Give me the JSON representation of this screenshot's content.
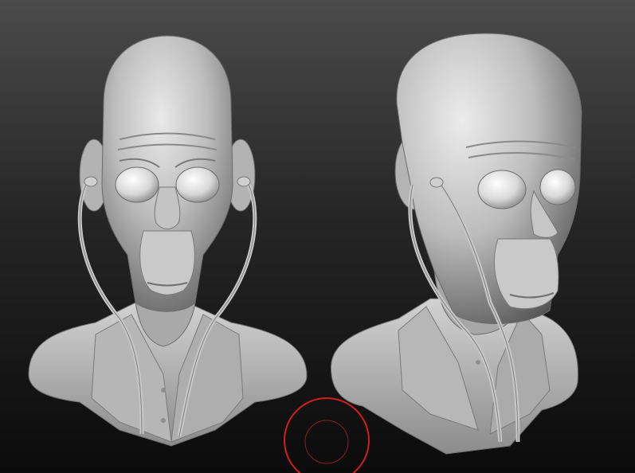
{
  "viewport": {
    "background_top": "#4a4a4a",
    "background_bottom": "#0d0d0d",
    "material_color": "#b9b9b9",
    "material_shadow": "#3c3c3c"
  },
  "models": [
    {
      "name": "bust-front-view",
      "icon": "sculpt-bust"
    },
    {
      "name": "bust-three-quarter-view",
      "icon": "sculpt-bust"
    }
  ],
  "cursor": {
    "icon": "brush-cursor-icon",
    "color": "#d21e1e"
  }
}
